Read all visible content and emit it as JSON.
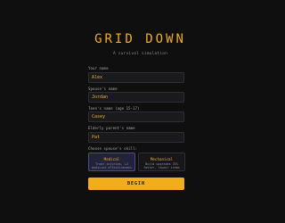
{
  "header": {
    "title": "GRID DOWN",
    "subtitle": "A survival simulation"
  },
  "form": {
    "your_name": {
      "label": "Your name",
      "value": "Alex"
    },
    "spouse_name": {
      "label": "Spouse's name",
      "value": "Jordan"
    },
    "teen_name": {
      "label": "Teen's name (age 15-17)",
      "value": "Casey"
    },
    "elderly_name": {
      "label": "Elderly parent's name",
      "value": "Pat"
    },
    "skill_prompt": "Choose spouse's skill:",
    "skills": [
      {
        "name": "Medical",
        "description": "Treat injuries, +2 medicine effectiveness",
        "selected": true
      },
      {
        "name": "Mechanical",
        "description": "Build upgrades 33% faster, repair items",
        "selected": false
      }
    ],
    "begin_label": "BEGIN"
  },
  "colors": {
    "background": "#0f0f10",
    "accent": "#f2ad1b",
    "input_bg": "#1a1a1d",
    "selected_card_bg": "#22223a"
  }
}
